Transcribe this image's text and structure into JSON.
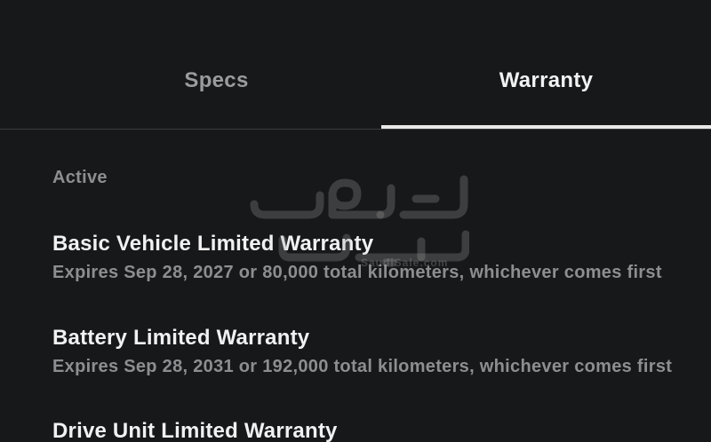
{
  "tabs": [
    {
      "label": "Specs",
      "active": false
    },
    {
      "label": "Warranty",
      "active": true
    }
  ],
  "section": {
    "label": "Active"
  },
  "warranties": [
    {
      "title": "Basic Vehicle Limited Warranty",
      "subtitle": "Expires Sep 28, 2027 or 80,000 total kilometers, whichever comes first"
    },
    {
      "title": "Battery Limited Warranty",
      "subtitle": "Expires Sep 28, 2031 or 192,000 total kilometers, whichever comes first"
    },
    {
      "title": "Drive Unit Limited Warranty"
    }
  ],
  "watermark": {
    "caption": "SaudiSale.com"
  },
  "colors": {
    "background": "#17181a",
    "active_text": "#f2f2f3",
    "inactive_text": "#9a9b9e",
    "indicator": "#e8e8e9"
  }
}
